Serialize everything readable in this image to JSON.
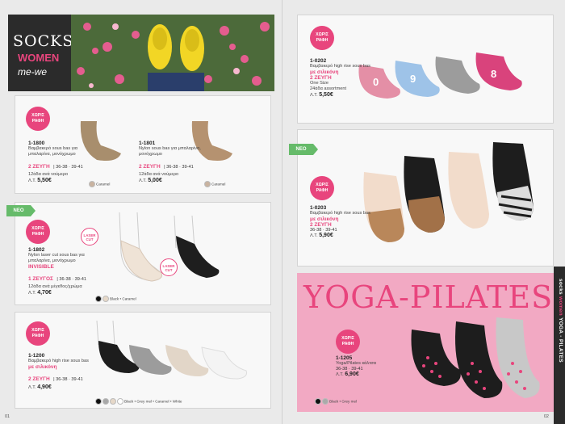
{
  "header": {
    "title": "SOCKS",
    "subtitle": "WOMEN",
    "brand": "me-we"
  },
  "products": [
    {
      "badge": "ΧΩΡΙΣ ΡΑΦΗ",
      "code": "1-1800",
      "desc": "Βαμβακερό sous bas για μπαλαρίνα, μονόχρωμο",
      "pairs": "2 ΖΕΥΓΗ",
      "sizes": "| 36-38 · 39-41",
      "pack": "12άδα ανά νούμερο",
      "price_label": "Λ.Τ.",
      "price": "5,50€",
      "colors": [
        "Caramel"
      ]
    },
    {
      "code": "1-1801",
      "desc": "Nylon sous bas για μπαλαρίνα, μονόχρωμο",
      "pairs": "2 ΖΕΥΓΗ",
      "sizes": "| 36-38 · 39-41",
      "pack": "12άδα ανά νούμερο",
      "price_label": "Λ.Τ.",
      "price": "5,00€",
      "colors": [
        "Caramel"
      ]
    },
    {
      "neo": "ΝΕΟ",
      "badge": "ΧΩΡΙΣ ΡΑΦΗ",
      "code": "1-1802",
      "desc": "Nylon laser cut sous bas για μπαλαρίνα, μονόχρωμο",
      "highlight": "INVISIBLE",
      "pairs": "1 ΖΕΥΓΟΣ",
      "sizes": "| 36-38 · 39-41",
      "pack": "12άδα ανά μέγεθος/χρώμα",
      "price_label": "Λ.Τ.",
      "price": "4,70€",
      "colors": "Black • Caramel",
      "laser": "LASER CUT"
    },
    {
      "badge": "ΧΩΡΙΣ ΡΑΦΗ",
      "code": "1-1200",
      "desc": "Βαμβακερό high rise sous bas",
      "highlight": "με σιλικόνη",
      "pairs": "2 ΖΕΥΓΗ",
      "sizes": "| 36-38 · 39-41",
      "price_label": "Λ.Τ.",
      "price": "4,90€",
      "colors": "Black • Grey mel • Caramel • White"
    },
    {
      "badge": "ΧΩΡΙΣ ΡΑΦΗ",
      "code": "1-0202",
      "desc": "Βαμβακερό high rise sous bas",
      "highlight": "με σιλικόνη",
      "pairs": "2 ΖΕΥΓΗ",
      "size_note": "One Size",
      "pack": "24άδα assortment",
      "price_label": "Λ.Τ.",
      "price": "5,50€"
    },
    {
      "neo": "ΝΕΟ",
      "badge": "ΧΩΡΙΣ ΡΑΦΗ",
      "code": "1-0203",
      "desc": "Βαμβακερό high rise sous bas",
      "highlight": "με σιλικόνη",
      "pairs": "2 ΖΕΥΓΗ",
      "sizes": "36-38 · 39-41",
      "price_label": "Λ.Τ.",
      "price": "5,90€"
    },
    {
      "badge": "ΧΩΡΙΣ ΡΑΦΗ",
      "code": "1-1205",
      "desc": "Yoga/Pilates κάλτσα",
      "sizes": "36-38 · 39-41",
      "price_label": "Λ.Τ.",
      "price": "6,90€",
      "colors": "Black • Grey mel"
    }
  ],
  "yoga_title": "YOGA-PILATES",
  "side_tab": {
    "a": "socks",
    "b": "women",
    "c": "YOGA - PILATES"
  },
  "page_numbers": {
    "left": "01",
    "right": "02"
  },
  "colors": {
    "accent": "#e8457d",
    "neo": "#66bb6a"
  }
}
